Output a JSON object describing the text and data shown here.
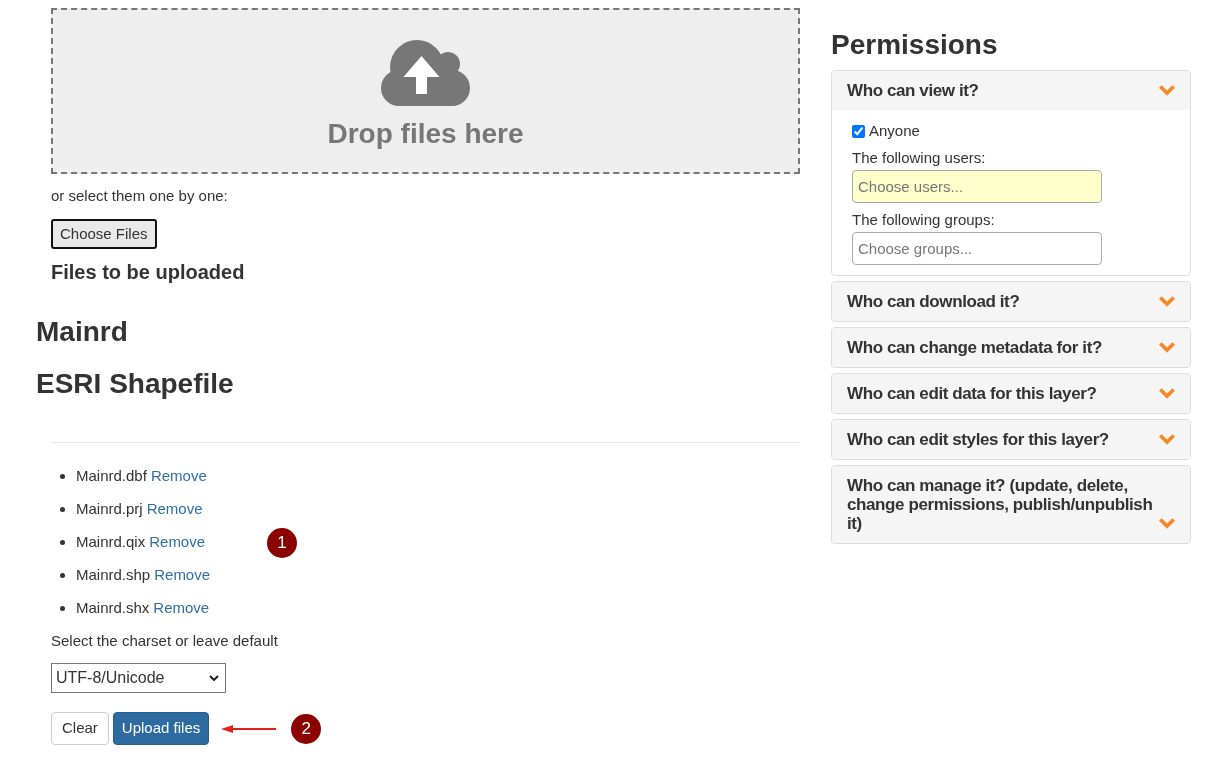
{
  "upload": {
    "dropzone_text": "Drop files here",
    "select_hint": "or select them one by one:",
    "choose_button": "Choose Files",
    "queue_heading": "Files to be uploaded"
  },
  "layer": {
    "name": "Mainrd",
    "type": "ESRI Shapefile"
  },
  "files": [
    {
      "name": "Mainrd.dbf",
      "action": "Remove"
    },
    {
      "name": "Mainrd.prj",
      "action": "Remove"
    },
    {
      "name": "Mainrd.qix",
      "action": "Remove",
      "marker": "1"
    },
    {
      "name": "Mainrd.shp",
      "action": "Remove"
    },
    {
      "name": "Mainrd.shx",
      "action": "Remove"
    }
  ],
  "charset": {
    "label": "Select the charset or leave default",
    "value": "UTF-8/Unicode"
  },
  "actions": {
    "buttons": [
      {
        "label": "Clear",
        "kind": "default"
      },
      {
        "label": "Upload files",
        "kind": "primary"
      }
    ],
    "arrow": true,
    "marker": "2"
  },
  "permissions": {
    "title": "Permissions",
    "panels": [
      {
        "title": "Who can view it?",
        "expanded": true,
        "anyone": {
          "label": "Anyone",
          "checked": true
        },
        "fields": [
          {
            "label": "The following users:",
            "placeholder": "Choose users...",
            "highlighted": true
          },
          {
            "label": "The following groups:",
            "placeholder": "Choose groups...",
            "highlighted": false
          }
        ]
      },
      {
        "title": "Who can download it?",
        "expanded": false
      },
      {
        "title": "Who can change metadata for it?",
        "expanded": false
      },
      {
        "title": "Who can edit data for this layer?",
        "expanded": false
      },
      {
        "title": "Who can edit styles for this layer?",
        "expanded": false
      },
      {
        "title": "Who can manage it? (update, delete, change permissions, publish/unpublish it)",
        "expanded": false
      }
    ]
  }
}
